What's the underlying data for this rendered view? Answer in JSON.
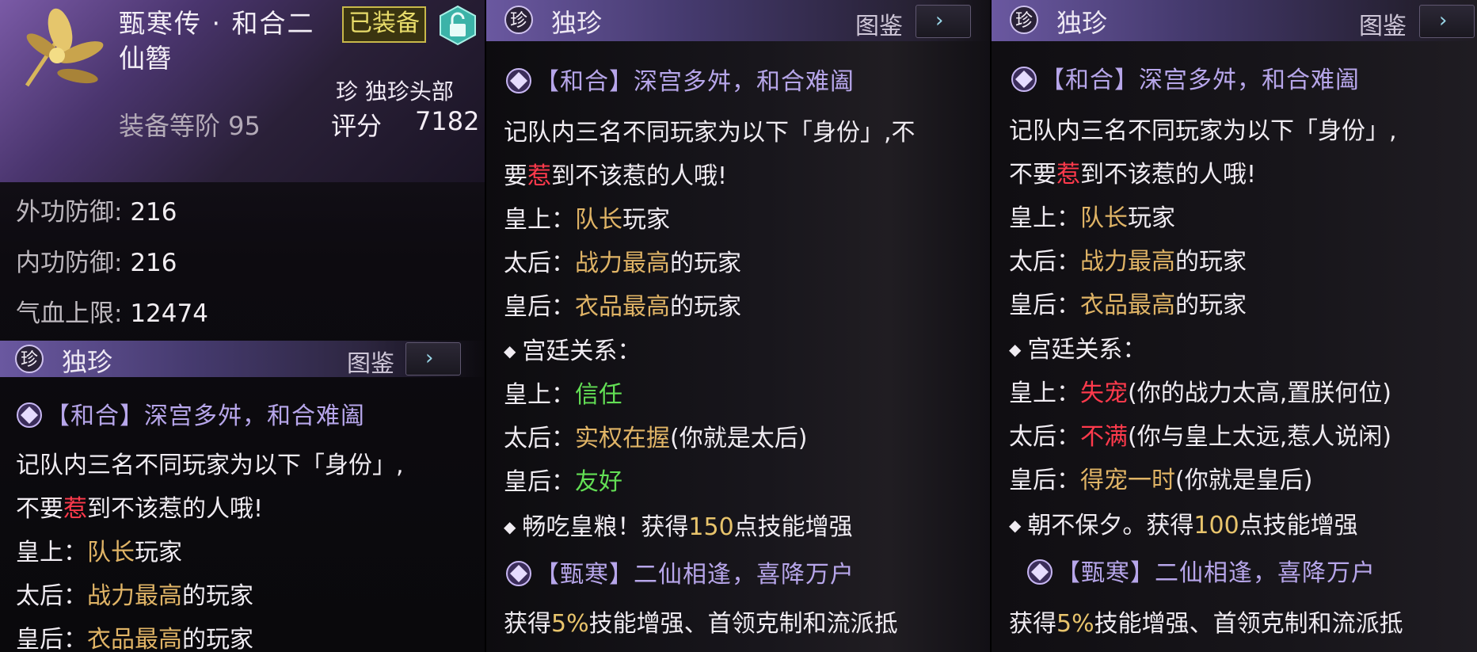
{
  "item": {
    "name_line1": "甄寒传 · 和合二",
    "name_line2": "仙簪",
    "equipped_label": "已装备",
    "rarity_category": "珍 独珍头部",
    "level_label": "装备等阶 95",
    "score_label": "评分",
    "score_value": "7182"
  },
  "stats": [
    {
      "label": "外功防御:",
      "value": "216"
    },
    {
      "label": "内功防御:",
      "value": "216"
    },
    {
      "label": "气血上限:",
      "value": "12474"
    }
  ],
  "section": {
    "badge": "珍",
    "title": "独珍",
    "catalog_label": "图鉴",
    "arrow": "›"
  },
  "effects": {
    "set1_head": "【和合】深宫多舛，和合难阖",
    "desc_a": "记队内三名不同玩家为以下「身份」,不",
    "desc_a_wrapped": "记队内三名不同玩家为以下「身份」,",
    "desc_b_pre": "要",
    "desc_b_pre_full": "不要",
    "desc_b_red": "惹",
    "desc_b_post": "到不该惹的人哦!",
    "role_emperor": "皇上：",
    "role_dowager": "太后：",
    "role_empress": "皇后：",
    "emperor_gold": "队长",
    "emperor_rest": "玩家",
    "dowager_gold": "战力最高",
    "dowager_rest": "的玩家",
    "empress_gold": "衣品最高",
    "empress_rest": "的玩家",
    "relations_head": "宫廷关系：",
    "bullet": "◆"
  },
  "middle": {
    "emperor_rel": "信任",
    "dowager_rel": "实权在握",
    "dowager_note": "(你就是太后)",
    "empress_rel": "友好",
    "bonus_pre": "畅吃皇粮！获得",
    "bonus_num": "150",
    "bonus_post": "点技能增强",
    "set2_head": "【甄寒】二仙相逢，喜降万户",
    "set2_pre": "获得",
    "set2_num": "5%",
    "set2_post": "技能增强、首领克制和流派抵"
  },
  "right": {
    "emperor_rel": "失宠",
    "emperor_note": "(你的战力太高,置朕何位)",
    "dowager_rel": "不满",
    "dowager_note": "(你与皇上太远,惹人说闲)",
    "empress_rel": "得宠一时",
    "empress_note": "(你就是皇后)",
    "bonus_pre": "朝不保夕。获得",
    "bonus_num": "100",
    "bonus_post": "点技能增强",
    "set2_head": "【甄寒】二仙相逢，喜降万户",
    "set2_pre": "获得",
    "set2_num": "5%",
    "set2_post": "技能增强、首领克制和流派抵"
  },
  "colors": {
    "gold": "#e0b466",
    "red": "#ff3a4c",
    "green": "#63df55",
    "set_purple": "#b7a6ea"
  }
}
